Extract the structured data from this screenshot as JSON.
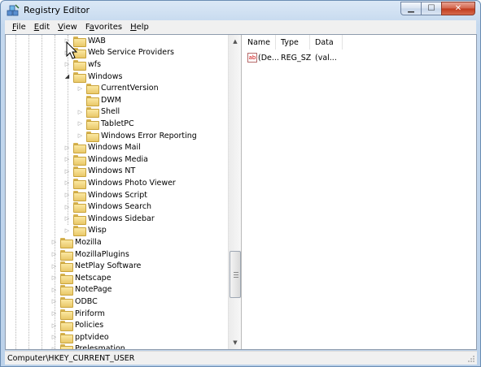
{
  "window": {
    "title": "Registry Editor"
  },
  "menu": [
    "File",
    "Edit",
    "View",
    "Favorites",
    "Help"
  ],
  "tree": [
    {
      "label": "WAB",
      "level": 2,
      "expander": "collapsed"
    },
    {
      "label": "Web Service Providers",
      "level": 2,
      "expander": "collapsed"
    },
    {
      "label": "wfs",
      "level": 2,
      "expander": "collapsed"
    },
    {
      "label": "Windows",
      "level": 2,
      "expander": "expanded"
    },
    {
      "label": "CurrentVersion",
      "level": 3,
      "expander": "collapsed"
    },
    {
      "label": "DWM",
      "level": 3,
      "expander": "none"
    },
    {
      "label": "Shell",
      "level": 3,
      "expander": "collapsed"
    },
    {
      "label": "TabletPC",
      "level": 3,
      "expander": "collapsed"
    },
    {
      "label": "Windows Error Reporting",
      "level": 3,
      "expander": "collapsed"
    },
    {
      "label": "Windows Mail",
      "level": 2,
      "expander": "collapsed"
    },
    {
      "label": "Windows Media",
      "level": 2,
      "expander": "collapsed"
    },
    {
      "label": "Windows NT",
      "level": 2,
      "expander": "collapsed"
    },
    {
      "label": "Windows Photo Viewer",
      "level": 2,
      "expander": "collapsed"
    },
    {
      "label": "Windows Script",
      "level": 2,
      "expander": "collapsed"
    },
    {
      "label": "Windows Search",
      "level": 2,
      "expander": "collapsed"
    },
    {
      "label": "Windows Sidebar",
      "level": 2,
      "expander": "collapsed"
    },
    {
      "label": "Wisp",
      "level": 2,
      "expander": "collapsed"
    },
    {
      "label": "Mozilla",
      "level": 1,
      "expander": "collapsed"
    },
    {
      "label": "MozillaPlugins",
      "level": 1,
      "expander": "collapsed"
    },
    {
      "label": "NetPlay Software",
      "level": 1,
      "expander": "collapsed"
    },
    {
      "label": "Netscape",
      "level": 1,
      "expander": "collapsed"
    },
    {
      "label": "NotePage",
      "level": 1,
      "expander": "collapsed"
    },
    {
      "label": "ODBC",
      "level": 1,
      "expander": "collapsed"
    },
    {
      "label": "Piriform",
      "level": 1,
      "expander": "collapsed"
    },
    {
      "label": "Policies",
      "level": 1,
      "expander": "collapsed"
    },
    {
      "label": "pptvideo",
      "level": 1,
      "expander": "collapsed"
    },
    {
      "label": "Prelesmation",
      "level": 1,
      "expander": "collapsed"
    }
  ],
  "list": {
    "columns": [
      "Name",
      "Type",
      "Data"
    ],
    "rows": [
      {
        "icon": "ab",
        "name": "(De...",
        "type": "REG_SZ",
        "data": "(val..."
      }
    ]
  },
  "statusbar": {
    "path": "Computer\\HKEY_CURRENT_USER"
  },
  "colors": {
    "folder": "#e9c869",
    "title_gradient": "#c4d8ee",
    "close": "#c0391b"
  }
}
